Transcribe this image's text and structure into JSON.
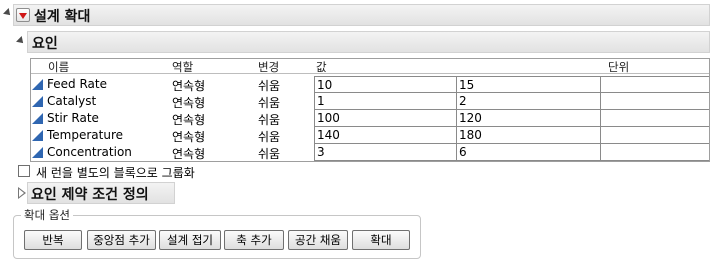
{
  "report": {
    "title": "설계 확대"
  },
  "factors": {
    "title": "요인",
    "columns": {
      "name": "이름",
      "role": "역할",
      "changes": "변경",
      "values": "값",
      "units": "단위"
    },
    "rows": [
      {
        "name": "Feed Rate",
        "role": "연속형",
        "changes": "쉬움",
        "low": "10",
        "high": "15",
        "unit": ""
      },
      {
        "name": "Catalyst",
        "role": "연속형",
        "changes": "쉬움",
        "low": "1",
        "high": "2",
        "unit": ""
      },
      {
        "name": "Stir Rate",
        "role": "연속형",
        "changes": "쉬움",
        "low": "100",
        "high": "120",
        "unit": ""
      },
      {
        "name": "Temperature",
        "role": "연속형",
        "changes": "쉬움",
        "low": "140",
        "high": "180",
        "unit": ""
      },
      {
        "name": "Concentration",
        "role": "연속형",
        "changes": "쉬움",
        "low": "3",
        "high": "6",
        "unit": ""
      }
    ],
    "group_runs_label": "새 런을 별도의 블록으로 그룹화",
    "group_runs_checked": false
  },
  "constraints": {
    "title": "요인 제약 조건 정의"
  },
  "augment_options": {
    "label": "확대 옵션",
    "buttons": {
      "replicate": "반복",
      "add_center": "중앙점 추가",
      "fold_over": "설계 접기",
      "add_axial": "축 추가",
      "space_filling": "공간 채움",
      "augment": "확대"
    }
  },
  "colors": {
    "hotspot_red": "#d01616",
    "factor_icon_blue": "#2f66b1"
  }
}
